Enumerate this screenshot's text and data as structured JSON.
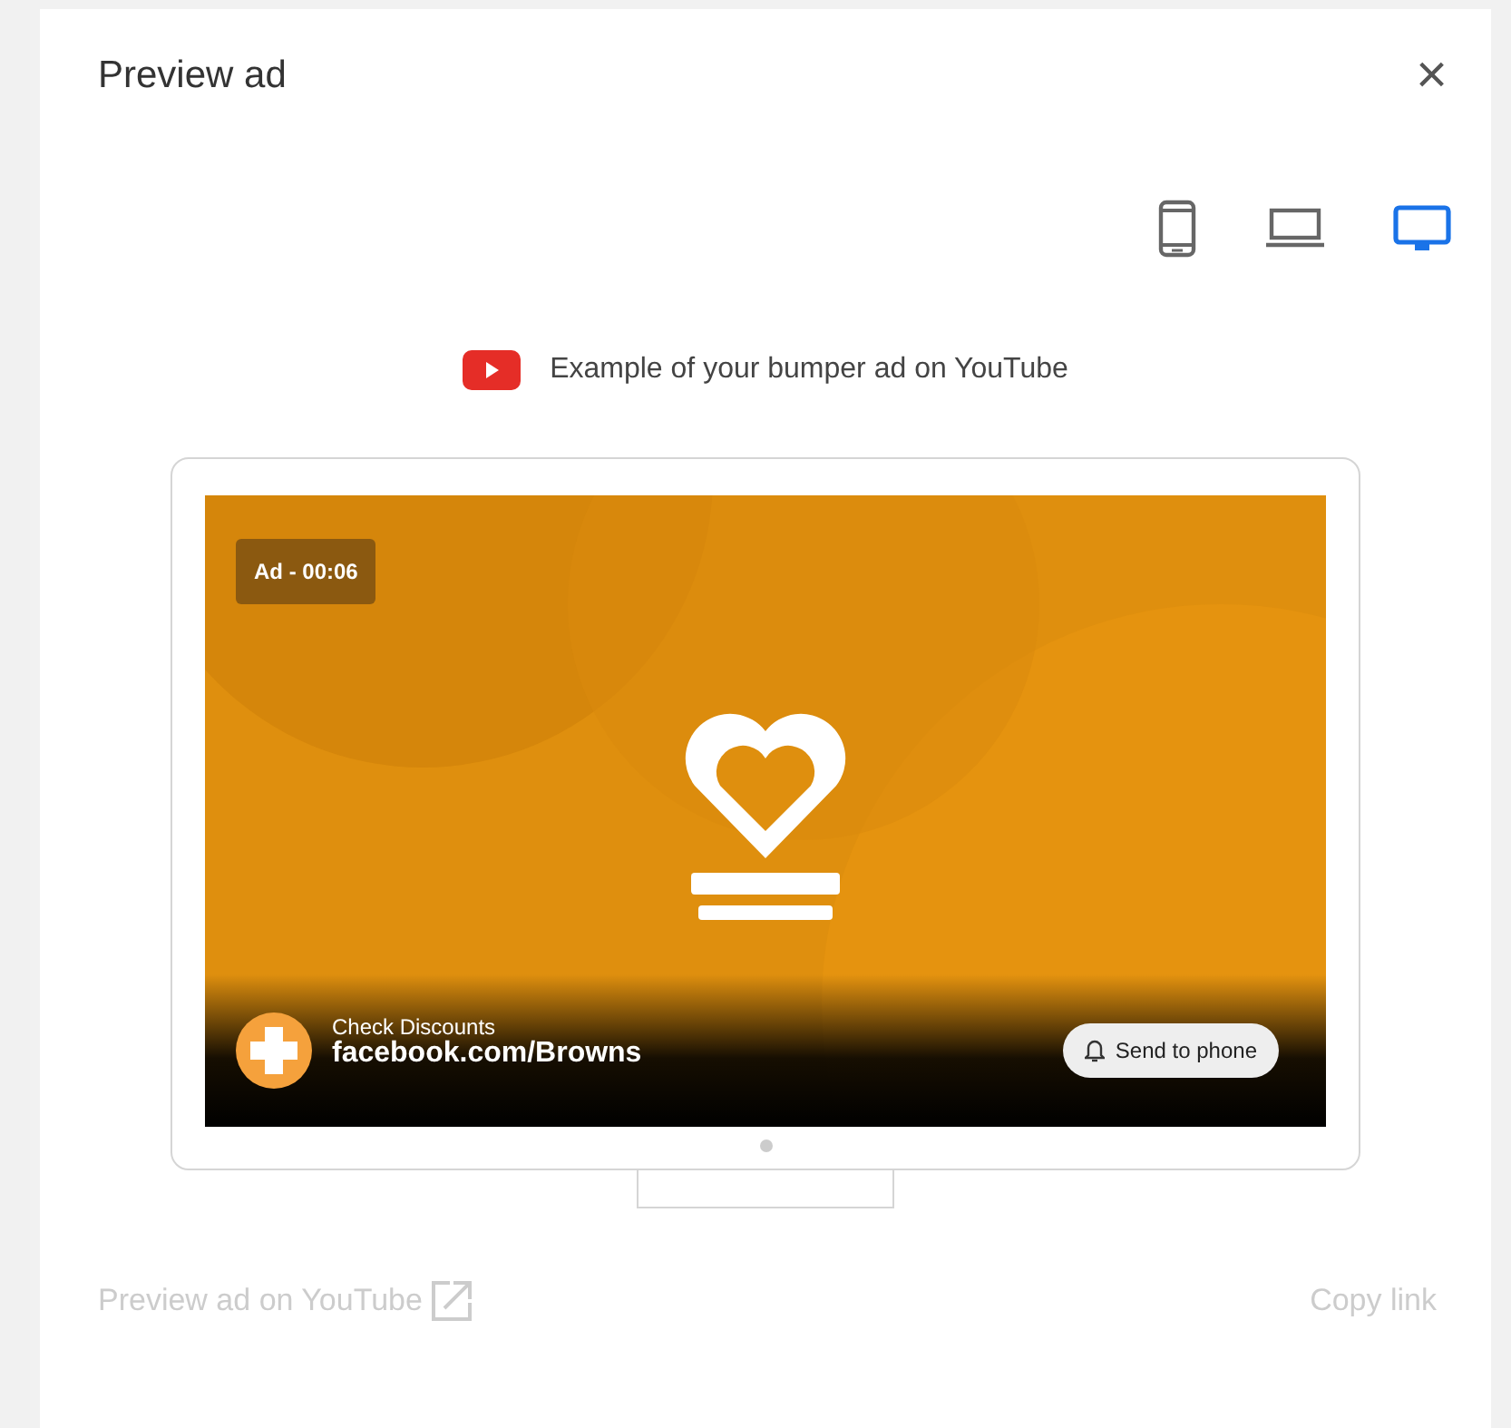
{
  "dialog": {
    "title": "Preview ad",
    "close": "×"
  },
  "devices": [
    {
      "kind": "phone",
      "selected": false
    },
    {
      "kind": "laptop",
      "selected": false
    },
    {
      "kind": "desktop",
      "selected": true
    }
  ],
  "caption": "Example of your bumper ad on YouTube",
  "video": {
    "kind": "picture",
    "ad_label": "Ad - 00:06",
    "headline": "Check Discounts",
    "url": "facebook.com/Browns",
    "action": "Send to phone"
  },
  "footer": [
    {
      "kind": "external",
      "label": "Preview ad on YouTube",
      "disabled": true
    },
    {
      "kind": "plain",
      "label": "Copy link",
      "disabled": true
    }
  ]
}
